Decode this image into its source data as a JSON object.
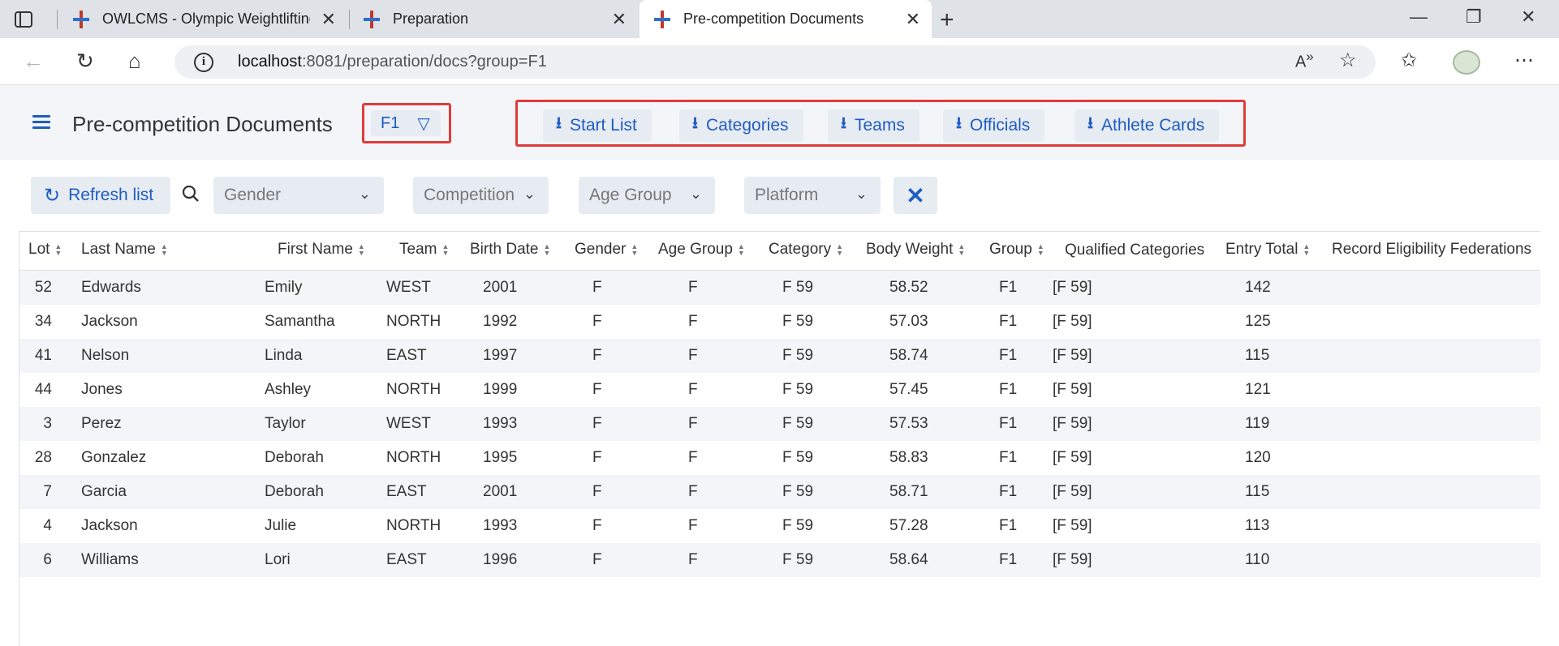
{
  "browser": {
    "tabs": [
      {
        "title": "OWLCMS - Olympic Weightlifting"
      },
      {
        "title": "Preparation"
      },
      {
        "title": "Pre-competition Documents"
      }
    ],
    "url_host": "localhost",
    "url_path": ":8081/preparation/docs?group=F1"
  },
  "header": {
    "title": "Pre-competition Documents",
    "group_value": "F1",
    "downloads": [
      "Start List",
      "Categories",
      "Teams",
      "Officials",
      "Athlete Cards"
    ]
  },
  "toolbar": {
    "refresh_label": "Refresh list",
    "filters": [
      "Gender",
      "Competition",
      "Age Group",
      "Platform"
    ]
  },
  "grid": {
    "columns": [
      "Lot",
      "Last Name",
      "First Name",
      "Team",
      "Birth Date",
      "Gender",
      "Age Group",
      "Category",
      "Body Weight",
      "Group",
      "Qualified Categories",
      "Entry Total",
      "Record Eligibility Federations"
    ],
    "rows": [
      [
        "52",
        "Edwards",
        "Emily",
        "WEST",
        "2001",
        "F",
        "F",
        "F 59",
        "58.52",
        "F1",
        "[F 59]",
        "142"
      ],
      [
        "34",
        "Jackson",
        "Samantha",
        "NORTH",
        "1992",
        "F",
        "F",
        "F 59",
        "57.03",
        "F1",
        "[F 59]",
        "125"
      ],
      [
        "41",
        "Nelson",
        "Linda",
        "EAST",
        "1997",
        "F",
        "F",
        "F 59",
        "58.74",
        "F1",
        "[F 59]",
        "115"
      ],
      [
        "44",
        "Jones",
        "Ashley",
        "NORTH",
        "1999",
        "F",
        "F",
        "F 59",
        "57.45",
        "F1",
        "[F 59]",
        "121"
      ],
      [
        "3",
        "Perez",
        "Taylor",
        "WEST",
        "1993",
        "F",
        "F",
        "F 59",
        "57.53",
        "F1",
        "[F 59]",
        "119"
      ],
      [
        "28",
        "Gonzalez",
        "Deborah",
        "NORTH",
        "1995",
        "F",
        "F",
        "F 59",
        "58.83",
        "F1",
        "[F 59]",
        "120"
      ],
      [
        "7",
        "Garcia",
        "Deborah",
        "EAST",
        "2001",
        "F",
        "F",
        "F 59",
        "58.71",
        "F1",
        "[F 59]",
        "115"
      ],
      [
        "4",
        "Jackson",
        "Julie",
        "NORTH",
        "1993",
        "F",
        "F",
        "F 59",
        "57.28",
        "F1",
        "[F 59]",
        "113"
      ],
      [
        "6",
        "Williams",
        "Lori",
        "EAST",
        "1996",
        "F",
        "F",
        "F 59",
        "58.64",
        "F1",
        "[F 59]",
        "110"
      ]
    ]
  }
}
